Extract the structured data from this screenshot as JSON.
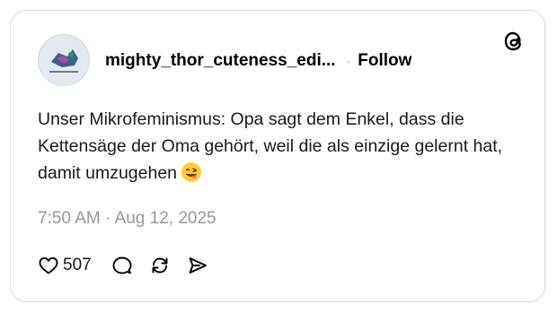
{
  "author": {
    "username": "mighty_thor_cuteness_edi...",
    "follow_label": "Follow",
    "separator": "·"
  },
  "post": {
    "text": "Unser Mikrofeminismus: Opa sagt dem Enkel, dass die Kettensäge der Oma gehört, weil die als einzige gelernt hat, damit umzugehen",
    "emoji": "winking-face-with-tongue",
    "timestamp": "7:50 AM · Aug 12, 2025"
  },
  "stats": {
    "likes": "507"
  },
  "icons": {
    "logo": "threads-logo-icon",
    "like": "heart-icon",
    "reply": "comment-icon",
    "repost": "repost-icon",
    "share": "send-icon"
  },
  "colors": {
    "text": "#1a1a1a",
    "muted": "#999999",
    "border": "#d9d9d9"
  }
}
